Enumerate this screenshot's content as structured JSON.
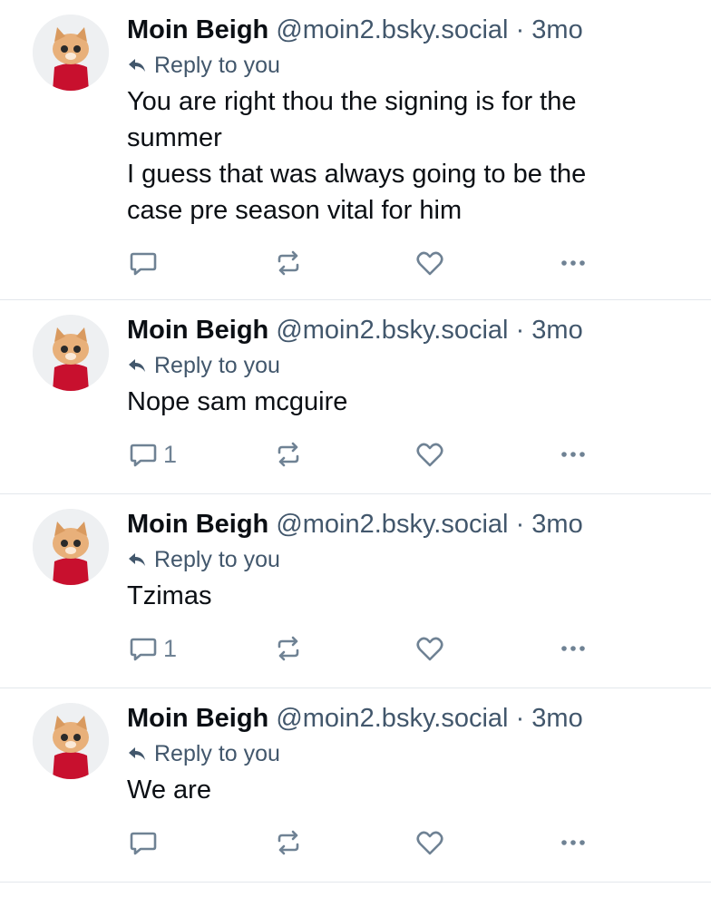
{
  "posts": [
    {
      "author": "Moin Beigh",
      "handle": "@moin2.bsky.social",
      "separator": "·",
      "time": "3mo",
      "reply_label": "Reply to you",
      "text_lines": [
        "You are right thou the signing is for the",
        "summer",
        "I guess that was always going to be the",
        "case pre season vital for him"
      ],
      "reply_count": ""
    },
    {
      "author": "Moin Beigh",
      "handle": "@moin2.bsky.social",
      "separator": "·",
      "time": "3mo",
      "reply_label": "Reply to you",
      "text_lines": [
        "Nope sam mcguire"
      ],
      "reply_count": "1"
    },
    {
      "author": "Moin Beigh",
      "handle": "@moin2.bsky.social",
      "separator": "·",
      "time": "3mo",
      "reply_label": "Reply to you",
      "text_lines": [
        "Tzimas"
      ],
      "reply_count": "1"
    },
    {
      "author": "Moin Beigh",
      "handle": "@moin2.bsky.social",
      "separator": "·",
      "time": "3mo",
      "reply_label": "Reply to you",
      "text_lines": [
        "We are"
      ],
      "reply_count": ""
    }
  ],
  "icons": {
    "reply": "reply-icon",
    "repost": "repost-icon",
    "like": "heart-icon",
    "more": "more-icon",
    "reply_arrow": "reply-arrow-icon"
  },
  "colors": {
    "text": "#0b0f14",
    "secondary": "#42576c",
    "icon": "#6f8294",
    "divider": "#e3e7ec",
    "avatar_shirt": "#c8102e"
  }
}
